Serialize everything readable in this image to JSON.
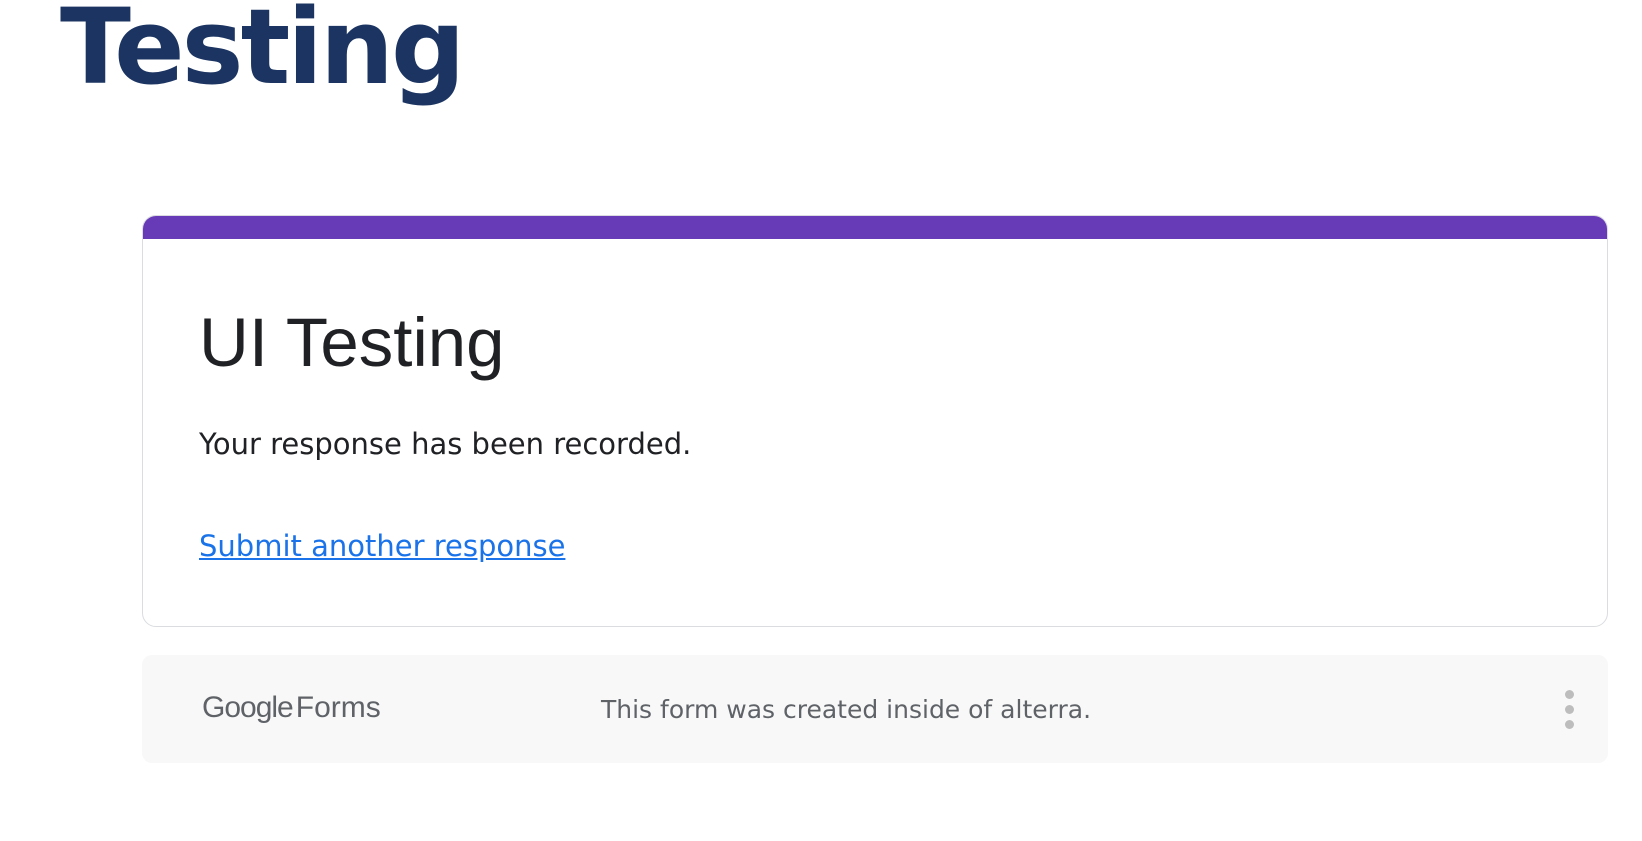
{
  "site": {
    "title": "Testing",
    "title_color": "#1b3461"
  },
  "form": {
    "accent_color": "#673ab7",
    "title": "UI Testing",
    "confirmation_message": "Your response has been recorded.",
    "submit_another_label": "Submit another response",
    "link_color": "#1a73e8"
  },
  "footer": {
    "logo": {
      "google": "Google",
      "forms": "Forms"
    },
    "note": "This form was created inside of alterra.",
    "menu_icon": "more-vert-icon"
  }
}
